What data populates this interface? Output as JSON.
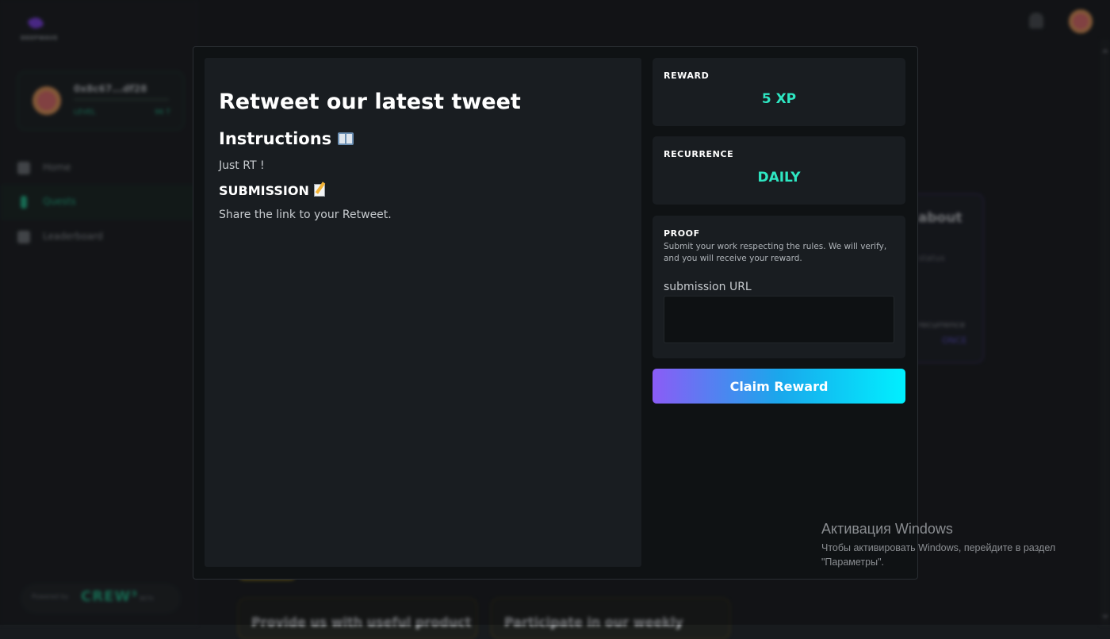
{
  "background": {
    "logo_text": "DEEPWAVE",
    "profile": {
      "address": "0x8c67...df28",
      "level": "LEVEL",
      "xp": "96 T"
    },
    "nav": [
      {
        "label": "Home",
        "icon": "home-icon"
      },
      {
        "label": "Quests",
        "icon": "bolt-icon",
        "active": true
      },
      {
        "label": "Leaderboard",
        "icon": "trophy-icon"
      }
    ],
    "powered_by": {
      "prefix": "Powered by",
      "brand": "CREW³",
      "badge": "BETA"
    },
    "right_card": {
      "title": "about",
      "line": "status",
      "recurrence_label": "recurrence",
      "recurrence_value": "ONCE"
    },
    "bottom_cards": [
      "Provide us with useful product",
      "Participate in our weekly"
    ]
  },
  "modal": {
    "quest_title": "Retweet our latest tweet",
    "instructions_heading": "Instructions",
    "instructions_text": "Just RT !",
    "submission_heading": "SUBMISSION",
    "submission_text": "Share the link to your Retweet.",
    "reward": {
      "label": "REWARD",
      "value": "5 XP"
    },
    "recurrence": {
      "label": "RECURRENCE",
      "value": "DAILY"
    },
    "proof": {
      "label": "PROOF",
      "description": "Submit your work respecting the rules. We will verify, and you will receive your reward.",
      "url_label": "submission URL",
      "url_value": ""
    },
    "claim_button": "Claim Reward"
  },
  "windows_watermark": {
    "title": "Активация Windows",
    "subtitle": "Чтобы активировать Windows, перейдите в раздел \"Параметры\"."
  },
  "colors": {
    "accent_teal": "#2ee6c2",
    "gradient_start": "#8b5cf6",
    "gradient_end": "#00f0ff",
    "modal_bg": "#0f1214"
  }
}
